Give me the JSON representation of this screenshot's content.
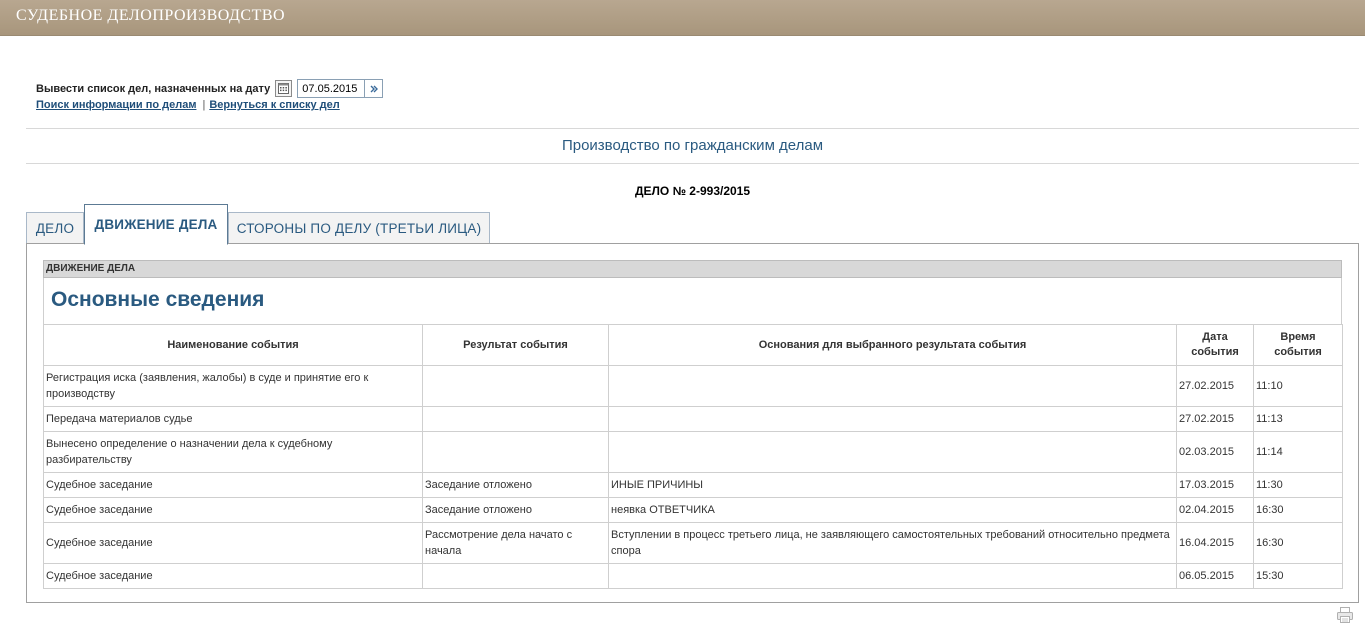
{
  "header": {
    "title": "СУДЕБНОЕ ДЕЛОПРОИЗВОДСТВО"
  },
  "date_filter": {
    "label": "Вывести список дел, назначенных на дату",
    "value": "07.05.2015",
    "calendar_icon": "calendar-icon",
    "go_icon": "go-icon"
  },
  "links": {
    "search": "Поиск информации по делам",
    "separator": "|",
    "back": "Вернуться к списку дел"
  },
  "section_title": "Производство по гражданским делам",
  "case_number": "ДЕЛО № 2-993/2015",
  "tabs": [
    {
      "label": "ДЕЛО",
      "active": false
    },
    {
      "label": "ДВИЖЕНИЕ ДЕЛА",
      "active": true
    },
    {
      "label": "СТОРОНЫ ПО ДЕЛУ (ТРЕТЬИ ЛИЦА)",
      "active": false
    }
  ],
  "panel": {
    "bar_label": "ДВИЖЕНИЕ ДЕЛА",
    "heading": "Основные сведения",
    "columns": [
      "Наименование события",
      "Результат события",
      "Основания для выбранного результата события",
      "Дата события",
      "Время события"
    ],
    "rows": [
      [
        "Регистрация иска (заявления, жалобы) в суде и принятие его к производству",
        "",
        "",
        "27.02.2015",
        "11:10"
      ],
      [
        "Передача материалов судье",
        "",
        "",
        "27.02.2015",
        "11:13"
      ],
      [
        "Вынесено определение о назначении дела к судебному разбирательству",
        "",
        "",
        "02.03.2015",
        "11:14"
      ],
      [
        "Судебное заседание",
        "Заседание отложено",
        "ИНЫЕ ПРИЧИНЫ",
        "17.03.2015",
        "11:30"
      ],
      [
        "Судебное заседание",
        "Заседание отложено",
        "неявка ОТВЕТЧИКА",
        "02.04.2015",
        "16:30"
      ],
      [
        "Судебное заседание",
        "Рассмотрение дела начато с начала",
        "Вступлении в процесс третьего лица, не заявляющего самостоятельных требований относительно предмета спора",
        "16.04.2015",
        "16:30"
      ],
      [
        "Судебное заседание",
        "",
        "",
        "06.05.2015",
        "15:30"
      ]
    ]
  },
  "print_icon": "printer-icon"
}
